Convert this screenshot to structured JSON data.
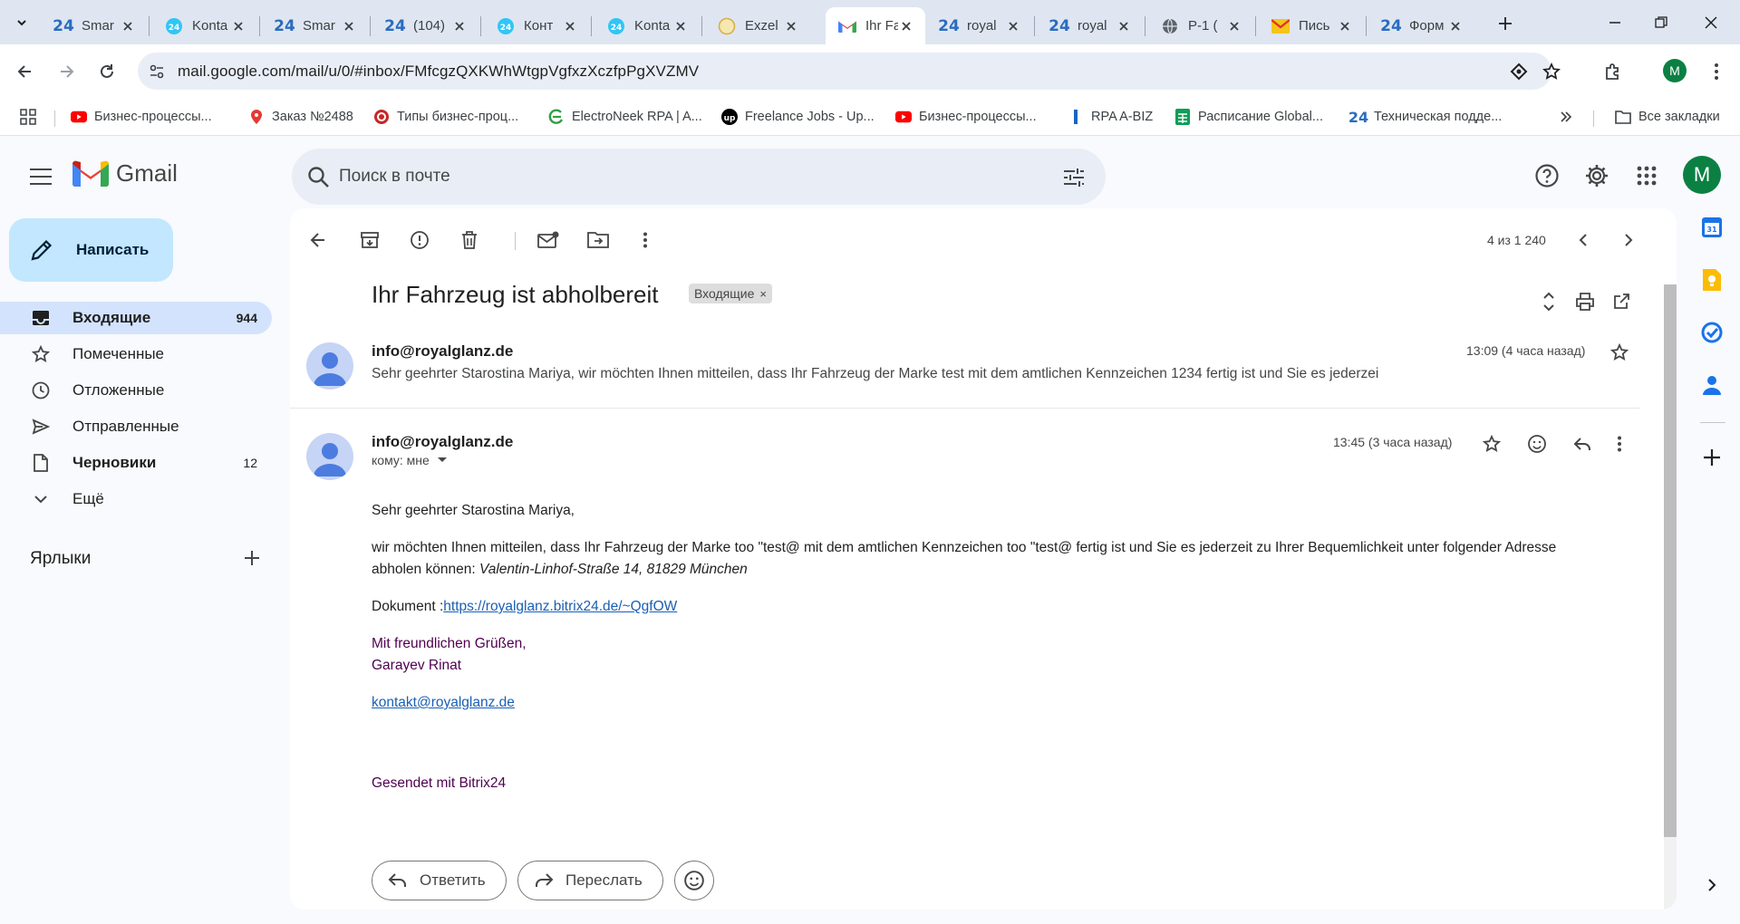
{
  "browser": {
    "tabs": [
      {
        "icon": "bitrix24-icon",
        "title": "Smar"
      },
      {
        "icon": "bitrix24-circle-icon",
        "title": "Konta"
      },
      {
        "icon": "bitrix24-icon",
        "title": "Smar"
      },
      {
        "icon": "bitrix24-icon",
        "title": "(104)"
      },
      {
        "icon": "bitrix24-circle-icon",
        "title": "Конт"
      },
      {
        "icon": "bitrix24-circle-icon",
        "title": "Konta"
      },
      {
        "icon": "exzel-icon",
        "title": "Exzel"
      },
      {
        "icon": "gmail-icon",
        "title": "Ihr Fa"
      },
      {
        "icon": "bitrix24-icon",
        "title": "royal"
      },
      {
        "icon": "bitrix24-icon",
        "title": "royal"
      },
      {
        "icon": "globe-icon",
        "title": "P-1 ("
      },
      {
        "icon": "yandex-mail-icon",
        "title": "Пись"
      },
      {
        "icon": "bitrix24-icon",
        "title": "Форм"
      }
    ],
    "address_url": "mail.google.com/mail/u/0/#inbox/FMfcgzQXKWhWtgpVgfxzXczfpPgXVZMV",
    "profile_initial": "M",
    "bookmarks": [
      {
        "icon": "youtube-icon",
        "label": "Бизнес-процессы..."
      },
      {
        "icon": "location-pin-icon",
        "label": "Заказ №2488"
      },
      {
        "icon": "red-circle-icon",
        "label": "Типы бизнес-проц..."
      },
      {
        "icon": "electroneek-icon",
        "label": "ElectroNeek RPA | A..."
      },
      {
        "icon": "upwork-icon",
        "label": "Freelance Jobs - Up..."
      },
      {
        "icon": "youtube-icon",
        "label": "Бизнес-процессы..."
      },
      {
        "icon": "rpa-icon",
        "label": "RPA A-BIZ"
      },
      {
        "icon": "sheets-icon",
        "label": "Расписание Global..."
      },
      {
        "icon": "bitrix24-icon",
        "label": "Техническая подде..."
      }
    ],
    "all_bookmarks_label": "Все закладки"
  },
  "gmail": {
    "logo_text": "Gmail",
    "search_placeholder": "Поиск в почте",
    "avatar_initial": "M",
    "compose_label": "Написать",
    "nav": [
      {
        "label": "Входящие",
        "count": "944",
        "icon": "inbox-icon"
      },
      {
        "label": "Помеченные",
        "count": "",
        "icon": "star-icon"
      },
      {
        "label": "Отложенные",
        "count": "",
        "icon": "clock-icon"
      },
      {
        "label": "Отправленные",
        "count": "",
        "icon": "send-icon"
      },
      {
        "label": "Черновики",
        "count": "12",
        "icon": "draft-icon"
      },
      {
        "label": "Ещё",
        "count": "",
        "icon": "chevron-down-icon"
      }
    ],
    "labels_header": "Ярлыки",
    "pager": "4 из 1 240",
    "subject": "Ihr Fahrzeug ist abholbereit",
    "subject_label": "Входящие",
    "messages": [
      {
        "sender": "info@royalglanz.de",
        "time": "13:09 (4 часа назад)",
        "snippet": "Sehr geehrter Starostina Mariya, wir möchten Ihnen mitteilen, dass Ihr Fahrzeug der Marke test mit dem amtlichen Kennzeichen 1234 fertig ist und Sie es jederzei"
      },
      {
        "sender": "info@royalglanz.de",
        "time": "13:45 (3 часа назад)",
        "to_me": "кому: мне"
      }
    ],
    "body": {
      "greeting": "Sehr geehrter Starostina Mariya,",
      "para1": "wir möchten Ihnen mitteilen, dass Ihr Fahrzeug der Marke too \"test@ mit dem amtlichen Kennzeichen too \"test@ fertig ist und Sie es jederzeit zu Ihrer Bequemlichkeit unter folgender Adresse",
      "para1_line2": "abholen können: ",
      "address": "Valentin-Linhof-Straße 14, 81829 München",
      "doc_label": "Dokument :",
      "doc_link": "https://royalglanz.bitrix24.de/~QgfOW",
      "closing": "Mit freundlichen Grüßen,",
      "signature_name": "Garayev Rinat",
      "email_link": "kontakt@royalglanz.de",
      "sent_with": "Gesendet mit Bitrix24"
    },
    "reply_label": "Ответить",
    "forward_label": "Переслать"
  },
  "colors": {
    "accent": "#0b57d0",
    "compose_bg": "#c2e7ff",
    "active_nav_bg": "#d3e3fd",
    "avatar_green": "#0b8043",
    "signature_purple": "#500050",
    "link_blue": "#1a5fb4"
  }
}
